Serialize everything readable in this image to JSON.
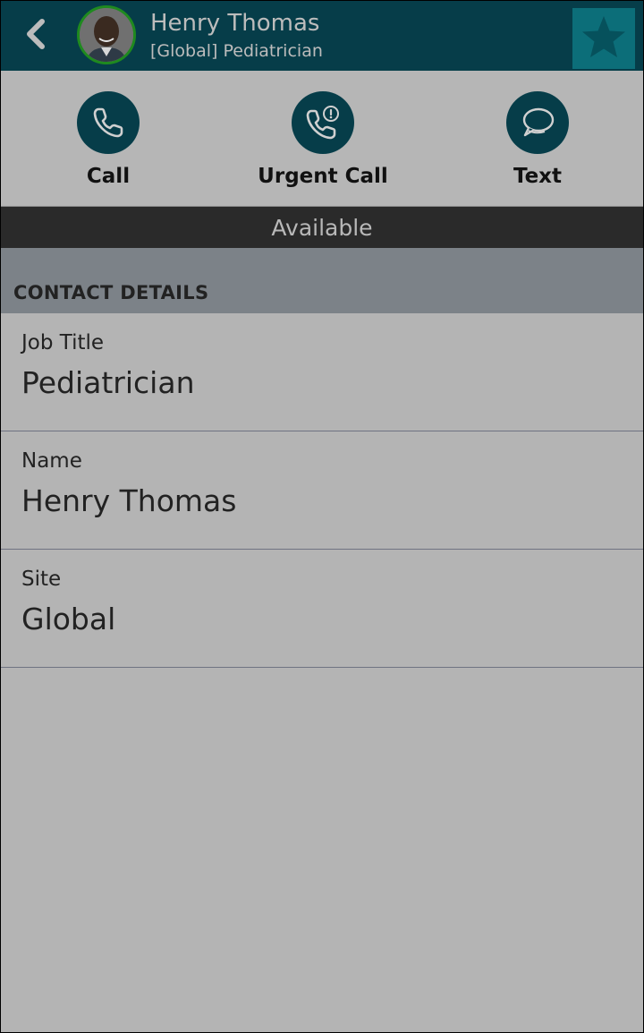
{
  "header": {
    "name": "Henry Thomas",
    "subtitle": "[Global] Pediatrician",
    "back_icon": "chevron-left-icon",
    "favorite_icon": "star-icon",
    "colors": {
      "bar": "#063d49",
      "favorite_bg": "#0c6e79",
      "avatar_ring": "#1f8a1f"
    }
  },
  "actions": [
    {
      "label": "Call",
      "icon": "phone-icon"
    },
    {
      "label": "Urgent Call",
      "icon": "urgent-phone-icon"
    },
    {
      "label": "Text",
      "icon": "chat-bubbles-icon"
    }
  ],
  "status": {
    "text": "Available"
  },
  "contact_details": {
    "section_title": "CONTACT DETAILS",
    "rows": [
      {
        "label": "Job Title",
        "value": "Pediatrician"
      },
      {
        "label": "Name",
        "value": "Henry Thomas"
      },
      {
        "label": "Site",
        "value": "Global"
      }
    ]
  }
}
